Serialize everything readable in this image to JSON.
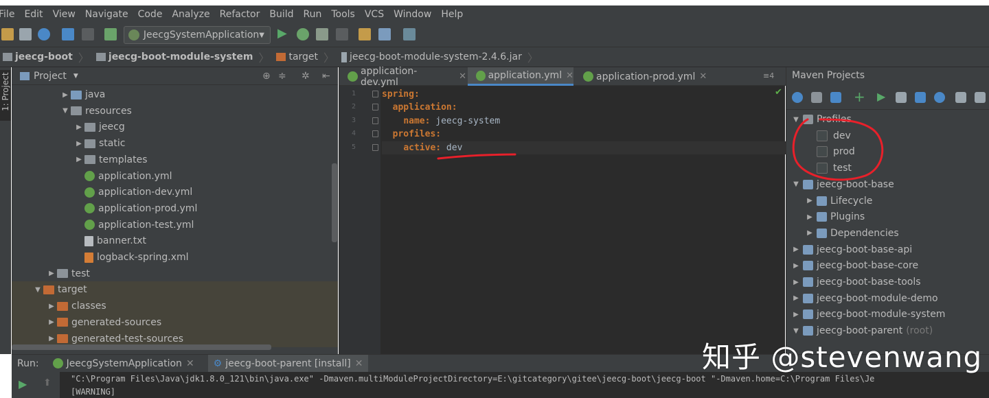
{
  "menu": [
    "File",
    "Edit",
    "View",
    "Navigate",
    "Code",
    "Analyze",
    "Refactor",
    "Build",
    "Run",
    "Tools",
    "VCS",
    "Window",
    "Help"
  ],
  "toolbar": {
    "run_config": "JeecgSystemApplication"
  },
  "breadcrumbs": [
    "jeecg-boot",
    "jeecg-boot-module-system",
    "target",
    "jeecg-boot-module-system-2.4.6.jar"
  ],
  "left_stripe": {
    "project_tab": "1: Project"
  },
  "project": {
    "title": "Project",
    "tree": [
      {
        "label": "java",
        "indent": 5,
        "arrow": "▶",
        "icon": "fold-blue"
      },
      {
        "label": "resources",
        "indent": 5,
        "arrow": "▼",
        "icon": "fold-grey"
      },
      {
        "label": "jeecg",
        "indent": 6,
        "arrow": "▶",
        "icon": "fold-grey"
      },
      {
        "label": "static",
        "indent": 6,
        "arrow": "▶",
        "icon": "fold-grey"
      },
      {
        "label": "templates",
        "indent": 6,
        "arrow": "▶",
        "icon": "fold-grey"
      },
      {
        "label": "application.yml",
        "indent": 6,
        "arrow": "",
        "icon": "spring"
      },
      {
        "label": "application-dev.yml",
        "indent": 6,
        "arrow": "",
        "icon": "spring"
      },
      {
        "label": "application-prod.yml",
        "indent": 6,
        "arrow": "",
        "icon": "spring"
      },
      {
        "label": "application-test.yml",
        "indent": 6,
        "arrow": "",
        "icon": "spring"
      },
      {
        "label": "banner.txt",
        "indent": 6,
        "arrow": "",
        "icon": "txtico"
      },
      {
        "label": "logback-spring.xml",
        "indent": 6,
        "arrow": "",
        "icon": "xmlico"
      },
      {
        "label": "test",
        "indent": 4,
        "arrow": "▶",
        "icon": "fold-grey"
      },
      {
        "label": "target",
        "indent": 3,
        "arrow": "▼",
        "icon": "fold-orange"
      },
      {
        "label": "classes",
        "indent": 4,
        "arrow": "▶",
        "icon": "fold-orange"
      },
      {
        "label": "generated-sources",
        "indent": 4,
        "arrow": "▶",
        "icon": "fold-orange"
      },
      {
        "label": "generated-test-sources",
        "indent": 4,
        "arrow": "▶",
        "icon": "fold-orange"
      }
    ]
  },
  "editor": {
    "tabs": [
      {
        "label": "application-dev.yml",
        "active": false
      },
      {
        "label": "application.yml",
        "active": true
      },
      {
        "label": "application-prod.yml",
        "active": false
      }
    ],
    "tab_overflow": "≡4",
    "lines": [
      {
        "no": "1",
        "key": "spring",
        "value": "",
        "indent": ""
      },
      {
        "no": "2",
        "key": "application",
        "value": "",
        "indent": "  "
      },
      {
        "no": "3",
        "key": "name",
        "value": " jeecg-system",
        "indent": "    "
      },
      {
        "no": "4",
        "key": "profiles",
        "value": "",
        "indent": "  "
      },
      {
        "no": "5",
        "key": "active",
        "value": " dev",
        "indent": "    "
      }
    ]
  },
  "maven": {
    "title": "Maven Projects",
    "rows": [
      {
        "label": "Profiles",
        "type": "folder",
        "arrow": "▼",
        "indent": 0
      },
      {
        "label": "dev",
        "type": "checkbox",
        "indent": 1
      },
      {
        "label": "prod",
        "type": "checkbox",
        "indent": 1
      },
      {
        "label": "test",
        "type": "checkbox",
        "indent": 1
      },
      {
        "label": "jeecg-boot-base",
        "type": "module",
        "arrow": "▼",
        "indent": 0
      },
      {
        "label": "Lifecycle",
        "type": "sub",
        "arrow": "▶",
        "indent": 1
      },
      {
        "label": "Plugins",
        "type": "sub",
        "arrow": "▶",
        "indent": 1
      },
      {
        "label": "Dependencies",
        "type": "sub",
        "arrow": "▶",
        "indent": 1
      },
      {
        "label": "jeecg-boot-base-api",
        "type": "module",
        "arrow": "▶",
        "indent": 0
      },
      {
        "label": "jeecg-boot-base-core",
        "type": "module",
        "arrow": "▶",
        "indent": 0
      },
      {
        "label": "jeecg-boot-base-tools",
        "type": "module",
        "arrow": "▶",
        "indent": 0
      },
      {
        "label": "jeecg-boot-module-demo",
        "type": "module",
        "arrow": "▶",
        "indent": 0
      },
      {
        "label": "jeecg-boot-module-system",
        "type": "module",
        "arrow": "▶",
        "indent": 0
      },
      {
        "label": "jeecg-boot-parent",
        "suffix": "(root)",
        "type": "module",
        "arrow": "▼",
        "indent": 0
      }
    ]
  },
  "run": {
    "label": "Run:",
    "tabs": [
      "JeecgSystemApplication",
      "jeecg-boot-parent [install]"
    ],
    "console": [
      "\"C:\\Program Files\\Java\\jdk1.8.0_121\\bin\\java.exe\" -Dmaven.multiModuleProjectDirectory=E:\\gitcategory\\gitee\\jeecg-boot\\jeecg-boot \"-Dmaven.home=C:\\Program Files\\Je",
      "[WARNING]"
    ]
  },
  "watermark": "知乎 @stevenwang"
}
